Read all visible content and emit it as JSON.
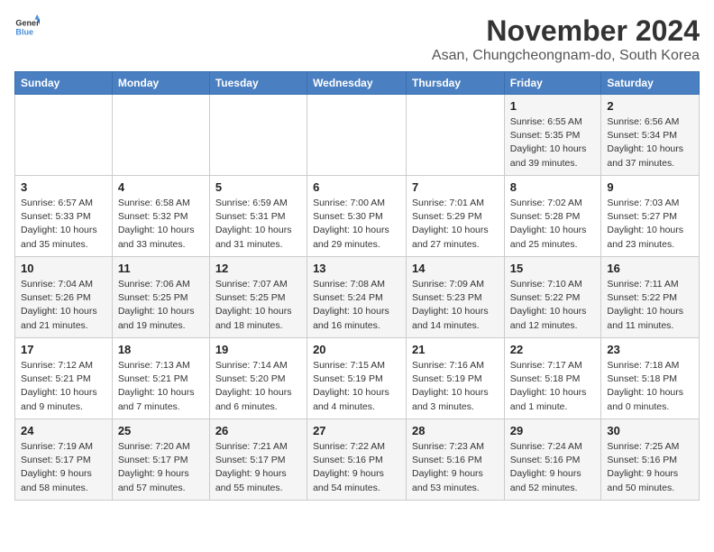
{
  "logo": {
    "line1": "General",
    "line2": "Blue"
  },
  "title": "November 2024",
  "subtitle": "Asan, Chungcheongnam-do, South Korea",
  "days_of_week": [
    "Sunday",
    "Monday",
    "Tuesday",
    "Wednesday",
    "Thursday",
    "Friday",
    "Saturday"
  ],
  "weeks": [
    [
      {
        "day": "",
        "info": ""
      },
      {
        "day": "",
        "info": ""
      },
      {
        "day": "",
        "info": ""
      },
      {
        "day": "",
        "info": ""
      },
      {
        "day": "",
        "info": ""
      },
      {
        "day": "1",
        "info": "Sunrise: 6:55 AM\nSunset: 5:35 PM\nDaylight: 10 hours and 39 minutes."
      },
      {
        "day": "2",
        "info": "Sunrise: 6:56 AM\nSunset: 5:34 PM\nDaylight: 10 hours and 37 minutes."
      }
    ],
    [
      {
        "day": "3",
        "info": "Sunrise: 6:57 AM\nSunset: 5:33 PM\nDaylight: 10 hours and 35 minutes."
      },
      {
        "day": "4",
        "info": "Sunrise: 6:58 AM\nSunset: 5:32 PM\nDaylight: 10 hours and 33 minutes."
      },
      {
        "day": "5",
        "info": "Sunrise: 6:59 AM\nSunset: 5:31 PM\nDaylight: 10 hours and 31 minutes."
      },
      {
        "day": "6",
        "info": "Sunrise: 7:00 AM\nSunset: 5:30 PM\nDaylight: 10 hours and 29 minutes."
      },
      {
        "day": "7",
        "info": "Sunrise: 7:01 AM\nSunset: 5:29 PM\nDaylight: 10 hours and 27 minutes."
      },
      {
        "day": "8",
        "info": "Sunrise: 7:02 AM\nSunset: 5:28 PM\nDaylight: 10 hours and 25 minutes."
      },
      {
        "day": "9",
        "info": "Sunrise: 7:03 AM\nSunset: 5:27 PM\nDaylight: 10 hours and 23 minutes."
      }
    ],
    [
      {
        "day": "10",
        "info": "Sunrise: 7:04 AM\nSunset: 5:26 PM\nDaylight: 10 hours and 21 minutes."
      },
      {
        "day": "11",
        "info": "Sunrise: 7:06 AM\nSunset: 5:25 PM\nDaylight: 10 hours and 19 minutes."
      },
      {
        "day": "12",
        "info": "Sunrise: 7:07 AM\nSunset: 5:25 PM\nDaylight: 10 hours and 18 minutes."
      },
      {
        "day": "13",
        "info": "Sunrise: 7:08 AM\nSunset: 5:24 PM\nDaylight: 10 hours and 16 minutes."
      },
      {
        "day": "14",
        "info": "Sunrise: 7:09 AM\nSunset: 5:23 PM\nDaylight: 10 hours and 14 minutes."
      },
      {
        "day": "15",
        "info": "Sunrise: 7:10 AM\nSunset: 5:22 PM\nDaylight: 10 hours and 12 minutes."
      },
      {
        "day": "16",
        "info": "Sunrise: 7:11 AM\nSunset: 5:22 PM\nDaylight: 10 hours and 11 minutes."
      }
    ],
    [
      {
        "day": "17",
        "info": "Sunrise: 7:12 AM\nSunset: 5:21 PM\nDaylight: 10 hours and 9 minutes."
      },
      {
        "day": "18",
        "info": "Sunrise: 7:13 AM\nSunset: 5:21 PM\nDaylight: 10 hours and 7 minutes."
      },
      {
        "day": "19",
        "info": "Sunrise: 7:14 AM\nSunset: 5:20 PM\nDaylight: 10 hours and 6 minutes."
      },
      {
        "day": "20",
        "info": "Sunrise: 7:15 AM\nSunset: 5:19 PM\nDaylight: 10 hours and 4 minutes."
      },
      {
        "day": "21",
        "info": "Sunrise: 7:16 AM\nSunset: 5:19 PM\nDaylight: 10 hours and 3 minutes."
      },
      {
        "day": "22",
        "info": "Sunrise: 7:17 AM\nSunset: 5:18 PM\nDaylight: 10 hours and 1 minute."
      },
      {
        "day": "23",
        "info": "Sunrise: 7:18 AM\nSunset: 5:18 PM\nDaylight: 10 hours and 0 minutes."
      }
    ],
    [
      {
        "day": "24",
        "info": "Sunrise: 7:19 AM\nSunset: 5:17 PM\nDaylight: 9 hours and 58 minutes."
      },
      {
        "day": "25",
        "info": "Sunrise: 7:20 AM\nSunset: 5:17 PM\nDaylight: 9 hours and 57 minutes."
      },
      {
        "day": "26",
        "info": "Sunrise: 7:21 AM\nSunset: 5:17 PM\nDaylight: 9 hours and 55 minutes."
      },
      {
        "day": "27",
        "info": "Sunrise: 7:22 AM\nSunset: 5:16 PM\nDaylight: 9 hours and 54 minutes."
      },
      {
        "day": "28",
        "info": "Sunrise: 7:23 AM\nSunset: 5:16 PM\nDaylight: 9 hours and 53 minutes."
      },
      {
        "day": "29",
        "info": "Sunrise: 7:24 AM\nSunset: 5:16 PM\nDaylight: 9 hours and 52 minutes."
      },
      {
        "day": "30",
        "info": "Sunrise: 7:25 AM\nSunset: 5:16 PM\nDaylight: 9 hours and 50 minutes."
      }
    ]
  ]
}
